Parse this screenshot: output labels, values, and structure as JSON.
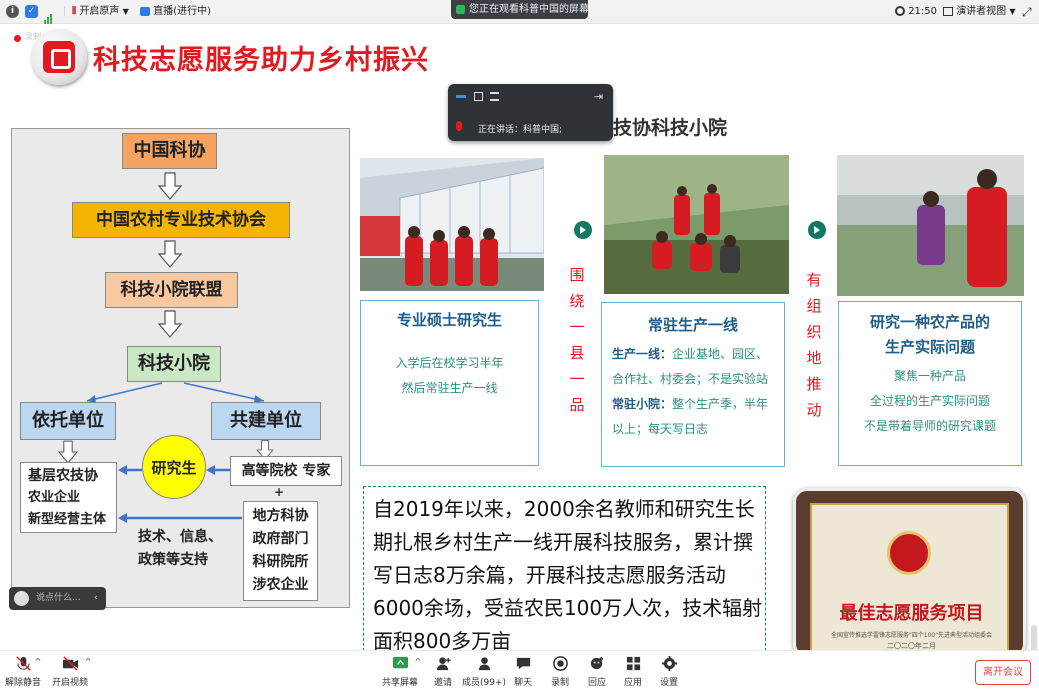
{
  "topbar": {
    "sound_label": "开启原声",
    "live_label": "直播(进行中)",
    "share_banner": "您正在观看科普中国的屏幕",
    "time": "21:50",
    "view_label": "演讲者视图"
  },
  "slide": {
    "rec_label": "录制",
    "title": "科技志愿服务助力乡村振兴",
    "diagram": {
      "level1": "中国科协",
      "level2": "中国农村专业技术协会",
      "level3": "科技小院联盟",
      "level4": "科技小院",
      "left_unit": "依托单位",
      "right_unit": "共建单位",
      "student": "研究生",
      "left_list": [
        "基层农技协",
        "农业企业",
        "新型经营主体"
      ],
      "right_top": "高等院校  专家",
      "plus": "+",
      "right_list": [
        "地方科协",
        "政府部门",
        "科研院所",
        "涉农企业"
      ],
      "support": [
        "技术、信息、",
        "政策等支持"
      ]
    },
    "section_heading": "中国农技协科技小院",
    "vertical_text_1": [
      "围",
      "绕",
      "一",
      "县",
      "一",
      "品"
    ],
    "vertical_text_2": [
      "有",
      "组",
      "织",
      "地",
      "推",
      "动"
    ],
    "card1": {
      "title": "专业硕士研究生",
      "lines": [
        "入学后在校学习半年",
        "然后常驻生产一线"
      ]
    },
    "card2": {
      "title": "常驻生产一线",
      "line1_bold": "生产一线：",
      "line1_rest": "企业基地、园区、",
      "line2": "合作社、村委会；不是实验站",
      "line3_bold": "常驻小院：",
      "line3_rest": "整个生产季，半年",
      "line4": "以上；每天写日志"
    },
    "card3": {
      "title_line1": "研究一种农产品的",
      "title_line2": "生产实际问题",
      "lines": [
        "聚焦一种产品",
        "全过程的生产实际问题",
        "不是带着导师的研究课题"
      ]
    },
    "summary": "自2019年以来，2000余名教师和研究生长期扎根乡村生产一线开展科技服务，累计撰写日志8万余篇，开展科技志愿服务活动6000余场，受益农民100万人次，技术辐射面积800多万亩",
    "plaque": {
      "title": "最佳志愿服务项目",
      "small": "全国宣传推选学雷锋志愿服务\"四个100\"先进典型活动组委会",
      "date": "二〇二〇年二月"
    }
  },
  "comment": {
    "placeholder": "说点什么..."
  },
  "speaker_popup": {
    "label": "正在讲话：",
    "name": "科普中国;"
  },
  "toolbar": {
    "mute": "解除静音",
    "video": "开启视频",
    "share": "共享屏幕",
    "invite": "邀请",
    "members": "成员(99+)",
    "chat": "聊天",
    "record": "录制",
    "replay": "回应",
    "apps": "应用",
    "settings": "设置",
    "leave": "离开会议"
  },
  "colors": {
    "title_red": "#e3191f",
    "card_border": "#63b5d8",
    "card_title": "#1f5d8a",
    "card_text": "#2f8f7f",
    "arrow_blue": "#3f74c9",
    "level1_bg": "#f4a460",
    "level2_bg": "#f5b400",
    "level3_bg": "#f8c8a0",
    "level4_bg": "#c9e8c3",
    "unit_bg": "#bcd7f0",
    "student_bg": "#ffff00"
  }
}
